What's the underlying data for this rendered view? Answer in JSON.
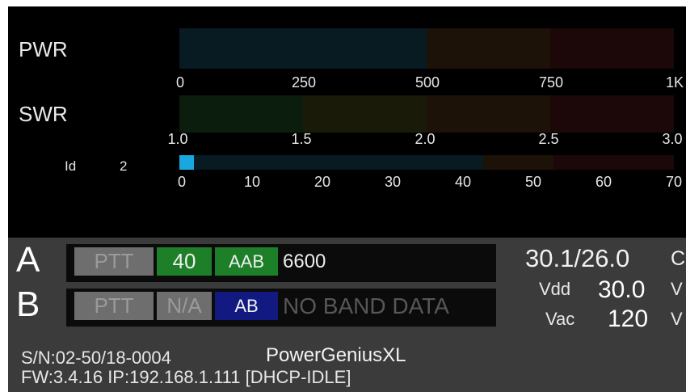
{
  "meters": {
    "pwr": {
      "label": "PWR",
      "ticks": [
        "0",
        "250",
        "500",
        "750",
        "1K"
      ],
      "zone_colors": [
        "#081a22",
        "#1c1207",
        "#1c0808"
      ]
    },
    "swr": {
      "label": "SWR",
      "ticks": [
        "1.0",
        "1.5",
        "2.0",
        "2.5",
        "3.0"
      ],
      "zone_colors": [
        "#0b1d0c",
        "#191a08",
        "#1c1207",
        "#1c0808"
      ]
    },
    "id": {
      "label": "Id",
      "value": "2",
      "ticks": [
        "0",
        "10",
        "20",
        "30",
        "40",
        "50",
        "60",
        "70"
      ],
      "zone_colors": [
        "#081a22",
        "#1c1207",
        "#1c0808"
      ],
      "fill_color": "#19a7e0",
      "fill_fraction": 0.029
    }
  },
  "radio_a": {
    "letter": "A",
    "ptt": "PTT",
    "band": "40",
    "antenna": "AAB",
    "frequency": "6600"
  },
  "radio_b": {
    "letter": "B",
    "ptt": "PTT",
    "band": "N/A",
    "antenna": "AB",
    "frequency": "NO BAND DATA"
  },
  "temperature": {
    "value": "30.1/26.0",
    "unit": "C"
  },
  "vdd": {
    "label": "Vdd",
    "value": "30.0",
    "unit": "V"
  },
  "vac": {
    "label": "Vac",
    "value": "120",
    "unit": "V"
  },
  "device": {
    "serial": "S/N:02-50/18-0004",
    "model": "PowerGeniusXL",
    "firmware_line": "FW:3.4.16  IP:192.168.1.111 [DHCP-IDLE]"
  },
  "colors": {
    "band_active": "#1d7f27",
    "antenna_b": "#121a82",
    "ptt_inactive": "#6e6e6e",
    "id_fill": "#19a7e0"
  }
}
